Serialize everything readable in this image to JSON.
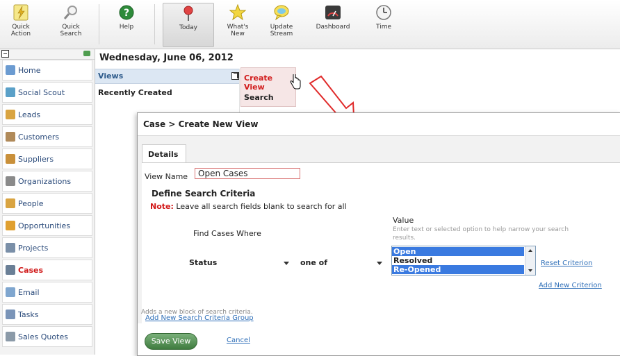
{
  "toolbar": {
    "items": [
      {
        "label1": "Quick",
        "label2": "Action",
        "icon": "lightning-icon"
      },
      {
        "label1": "Quick",
        "label2": "Search",
        "icon": "magnifier-icon"
      },
      {
        "label1": "Help",
        "label2": "",
        "icon": "question-icon"
      },
      {
        "label1": "Today",
        "label2": "",
        "icon": "pin-icon"
      },
      {
        "label1": "What's",
        "label2": "New",
        "icon": "star-icon"
      },
      {
        "label1": "Update",
        "label2": "Stream",
        "icon": "chat-icon"
      },
      {
        "label1": "Dashboard",
        "label2": "",
        "icon": "gauge-icon"
      },
      {
        "label1": "Time",
        "label2": "",
        "icon": "clock-icon"
      }
    ]
  },
  "sidebar": {
    "items": [
      {
        "label": "Home",
        "color": "#6b9bd1"
      },
      {
        "label": "Social Scout",
        "color": "#5aa0c8"
      },
      {
        "label": "Leads",
        "color": "#d9a441"
      },
      {
        "label": "Customers",
        "color": "#b08a5a"
      },
      {
        "label": "Suppliers",
        "color": "#c9903a"
      },
      {
        "label": "Organizations",
        "color": "#8a8a8a"
      },
      {
        "label": "People",
        "color": "#d9a441"
      },
      {
        "label": "Opportunities",
        "color": "#e0a030"
      },
      {
        "label": "Projects",
        "color": "#7a8fa8"
      },
      {
        "label": "Cases",
        "color": "#6a7f96"
      },
      {
        "label": "Email",
        "color": "#7fa6cf"
      },
      {
        "label": "Tasks",
        "color": "#7a94b8"
      },
      {
        "label": "Sales Quotes",
        "color": "#8b9aa8"
      }
    ]
  },
  "main": {
    "date": "Wednesday, June 06, 2012",
    "views": "Views",
    "recently_created": "Recently Created"
  },
  "menu": {
    "create_view": "Create View",
    "search": "Search"
  },
  "dialog": {
    "title": "Case > Create New View",
    "tab": "Details",
    "view_name_label": "View Name",
    "view_name_value": "Open Cases",
    "define_header": "Define Search Criteria",
    "note_label": "Note:",
    "note_text": " Leave all search fields blank to search for all",
    "find_where": "Find Cases Where",
    "value_header": "Value",
    "value_hint": "Enter text or selected option to help narrow your search results.",
    "field_select": "Status",
    "operator_select": "one of",
    "options": [
      {
        "label": "Open",
        "selected": true
      },
      {
        "label": "Resolved",
        "selected": false
      },
      {
        "label": "Re-Opened",
        "selected": true
      }
    ],
    "reset_criterion": "Reset Criterion",
    "add_new_criterion": "Add New Criterion",
    "add_group": "Add New Search Criteria Group",
    "add_group_hint": "Adds a new block of search criteria.",
    "save_button": "Save View",
    "cancel": "Cancel"
  }
}
